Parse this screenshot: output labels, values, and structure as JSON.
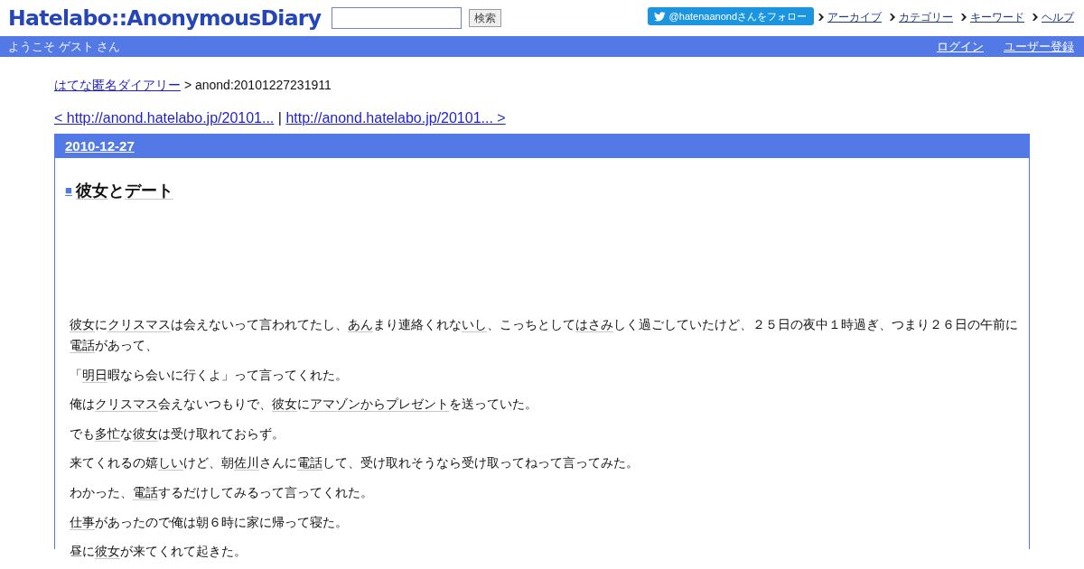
{
  "header": {
    "logo": "Hatelabo::AnonymousDiary",
    "search": {
      "button": "検索"
    },
    "follow_button": "@hatenaanondさんをフォロー",
    "links": [
      "アーカイブ",
      "カテゴリー",
      "キーワード",
      "ヘルプ"
    ]
  },
  "user_bar": {
    "greeting": "ようこそ ゲスト さん",
    "links": [
      "ログイン",
      "ユーザー登録"
    ]
  },
  "breadcrumb": {
    "link": "はてな匿名ダイアリー",
    "current": "> anond:20101227231911"
  },
  "pager": {
    "prev": "< http://anond.hatelabo.jp/20101...",
    "separator": "|",
    "next": "http://anond.hatelabo.jp/20101... >"
  },
  "day": {
    "date": "2010-12-27",
    "entry": {
      "marker": "■",
      "title": [
        {
          "text": "彼女",
          "keyword": true
        },
        {
          "text": "と",
          "keyword": false
        },
        {
          "text": "デート",
          "keyword": true
        }
      ],
      "paragraphs": [
        [
          {
            "text": "彼女",
            "keyword": true
          },
          {
            "text": "に",
            "keyword": false
          },
          {
            "text": "クリスマス",
            "keyword": true
          },
          {
            "text": "は会えないって言われてたし、",
            "keyword": false
          },
          {
            "text": "あん",
            "keyword": true
          },
          {
            "text": "まり連絡くれな",
            "keyword": false
          },
          {
            "text": "いし",
            "keyword": true
          },
          {
            "text": "、こっちとして",
            "keyword": false
          },
          {
            "text": "はさみ",
            "keyword": true
          },
          {
            "text": "しく過ごしていたけど、２５日の夜中１時過ぎ、つまり２６日の午前に",
            "keyword": false
          },
          {
            "text": "電話",
            "keyword": true
          },
          {
            "text": "があって、",
            "keyword": false
          }
        ],
        [
          {
            "text": "「",
            "keyword": false
          },
          {
            "text": "明日",
            "keyword": true
          },
          {
            "text": "暇なら会いに行くよ」って言ってくれた。",
            "keyword": false
          }
        ],
        [
          {
            "text": "俺は",
            "keyword": false
          },
          {
            "text": "クリスマス",
            "keyword": true
          },
          {
            "text": "会えないつもりで、",
            "keyword": false
          },
          {
            "text": "彼女",
            "keyword": true
          },
          {
            "text": "に",
            "keyword": false
          },
          {
            "text": "アマゾンからプレゼント",
            "keyword": true
          },
          {
            "text": "を送っていた。",
            "keyword": false
          }
        ],
        [
          {
            "text": "でも",
            "keyword": false
          },
          {
            "text": "多忙",
            "keyword": true
          },
          {
            "text": "な",
            "keyword": false
          },
          {
            "text": "彼女",
            "keyword": true
          },
          {
            "text": "は受け取れておらず。",
            "keyword": false
          }
        ],
        [
          {
            "text": "来てくれるの嬉",
            "keyword": false
          },
          {
            "text": "しい",
            "keyword": true
          },
          {
            "text": "けど、朝",
            "keyword": false
          },
          {
            "text": "佐川",
            "keyword": true
          },
          {
            "text": "さんに",
            "keyword": false
          },
          {
            "text": "電話",
            "keyword": true
          },
          {
            "text": "して、受け取れそうなら受け取ってねって言ってみた。",
            "keyword": false
          }
        ],
        [
          {
            "text": "わかった、",
            "keyword": false
          },
          {
            "text": "電話",
            "keyword": true
          },
          {
            "text": "するだけしてみるって言ってくれた。",
            "keyword": false
          }
        ],
        [
          {
            "text": "仕事",
            "keyword": true
          },
          {
            "text": "があったので俺は朝６時に家に帰って寝た。",
            "keyword": false
          }
        ],
        [
          {
            "text": "昼に",
            "keyword": false
          },
          {
            "text": "彼女",
            "keyword": true
          },
          {
            "text": "が来てくれて起きた。",
            "keyword": false
          }
        ]
      ]
    }
  }
}
